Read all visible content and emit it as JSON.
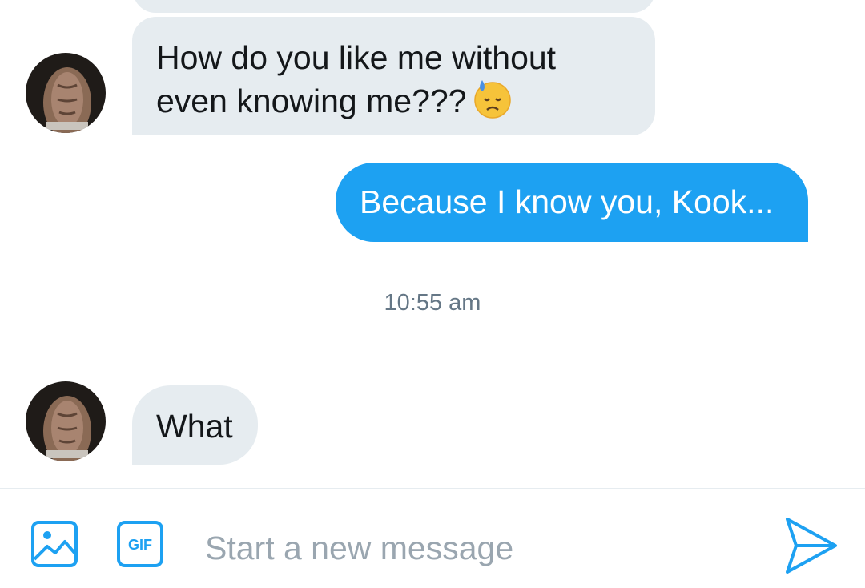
{
  "conversation": {
    "messages": [
      {
        "direction": "incoming",
        "text": "How do you like me without even knowing me???",
        "emoji": "downcast-face-with-sweat"
      },
      {
        "direction": "outgoing",
        "text": "Because I know you, Kook..."
      },
      {
        "direction": "incoming",
        "text": "What"
      }
    ],
    "timestamp": "10:55 am"
  },
  "composer": {
    "placeholder": "Start a new message",
    "value": "",
    "gif_label": "GIF",
    "icons": {
      "image": "image-icon",
      "gif": "gif-icon",
      "send": "send-icon"
    }
  },
  "colors": {
    "accent": "#1da1f2",
    "incoming_bubble": "#e6ecf0",
    "text": "#14171a",
    "muted": "#657786"
  }
}
